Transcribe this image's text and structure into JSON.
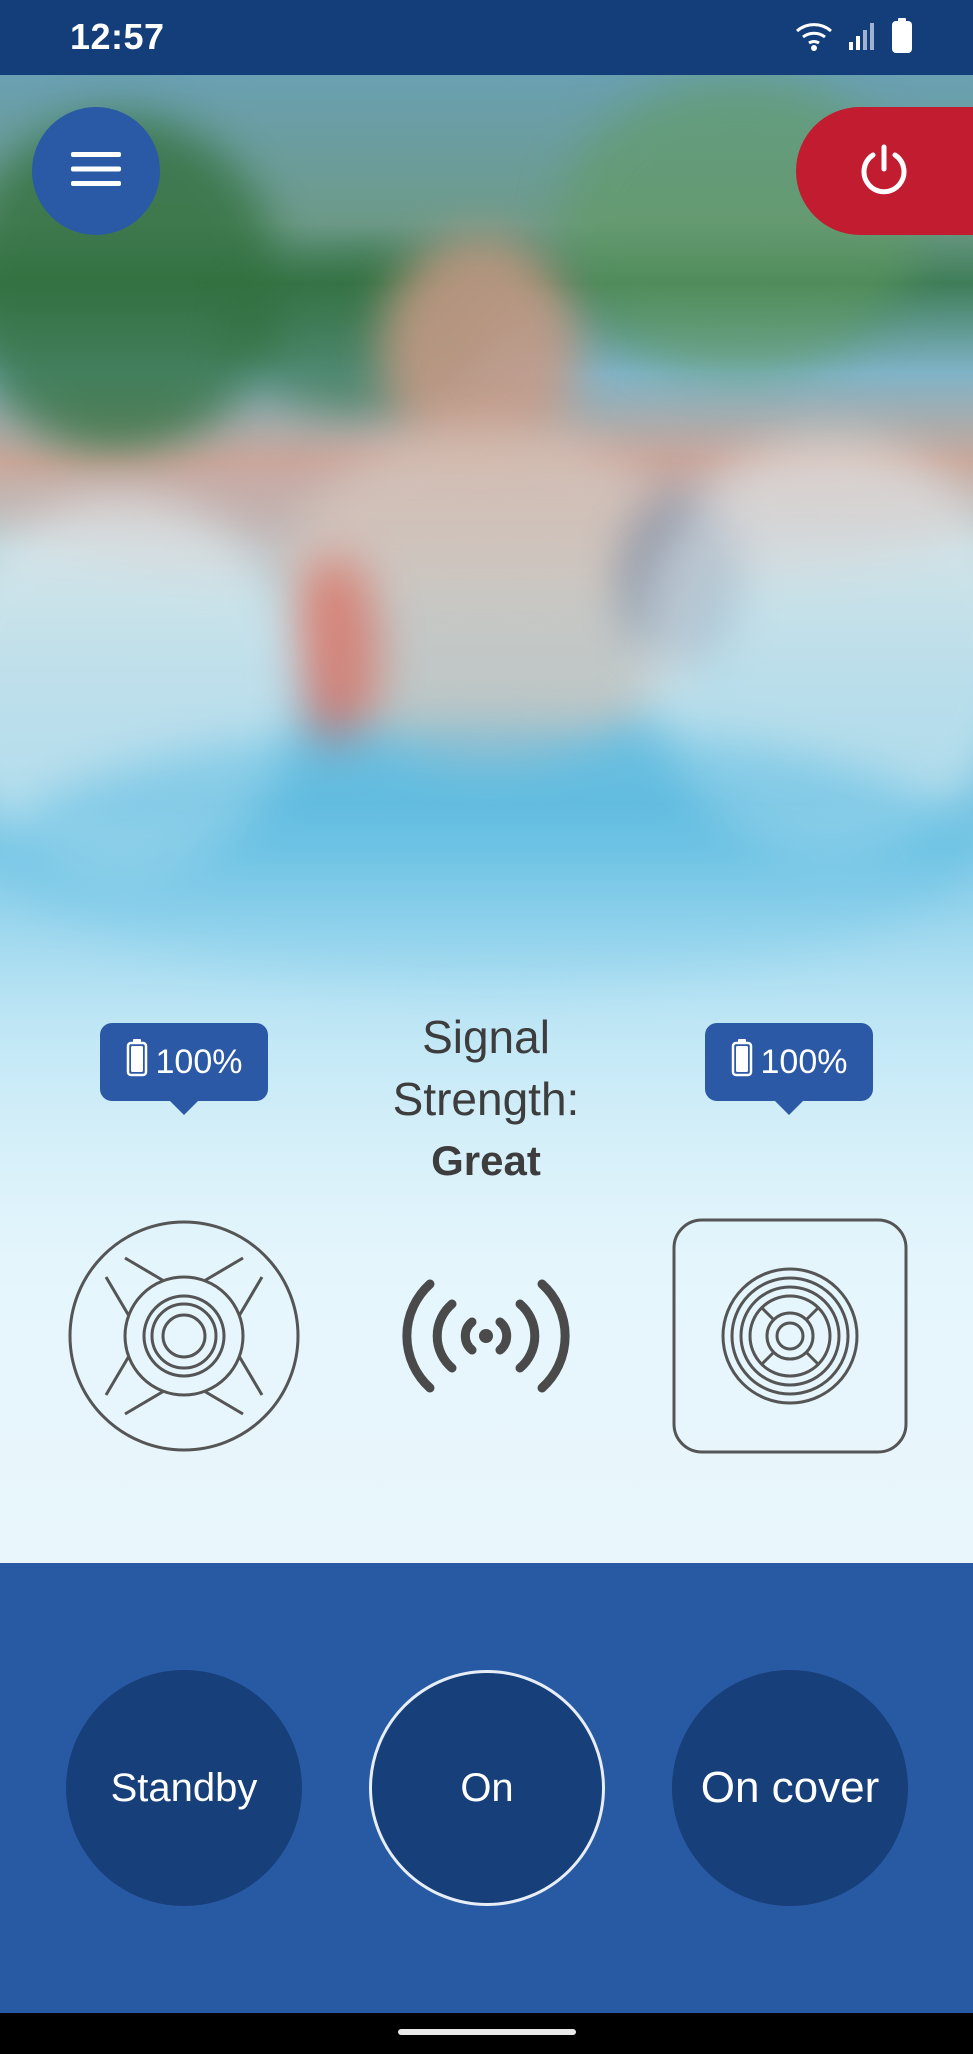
{
  "status_bar": {
    "time": "12:57",
    "icons": [
      "wifi-icon",
      "cell-signal-icon",
      "battery-icon"
    ]
  },
  "header": {
    "menu_icon": "hamburger-menu-icon",
    "power_icon": "power-icon",
    "power_color": "#c21c30",
    "menu_color": "#2a5aa6"
  },
  "devices": {
    "left": {
      "battery": "100%",
      "icon": "pool-cover-device-icon"
    },
    "right": {
      "battery": "100%",
      "icon": "pool-sensor-device-icon"
    }
  },
  "signal": {
    "label": "Signal Strength:",
    "value": "Great",
    "icon": "wireless-signal-icon"
  },
  "modes": {
    "standby": "Standby",
    "on": "On",
    "on_cover": "On cover",
    "selected": "On"
  },
  "colors": {
    "status_bar": "#143e79",
    "panel": "#285aa4",
    "mode_button": "#173f7a",
    "badge": "#2b59a6"
  }
}
